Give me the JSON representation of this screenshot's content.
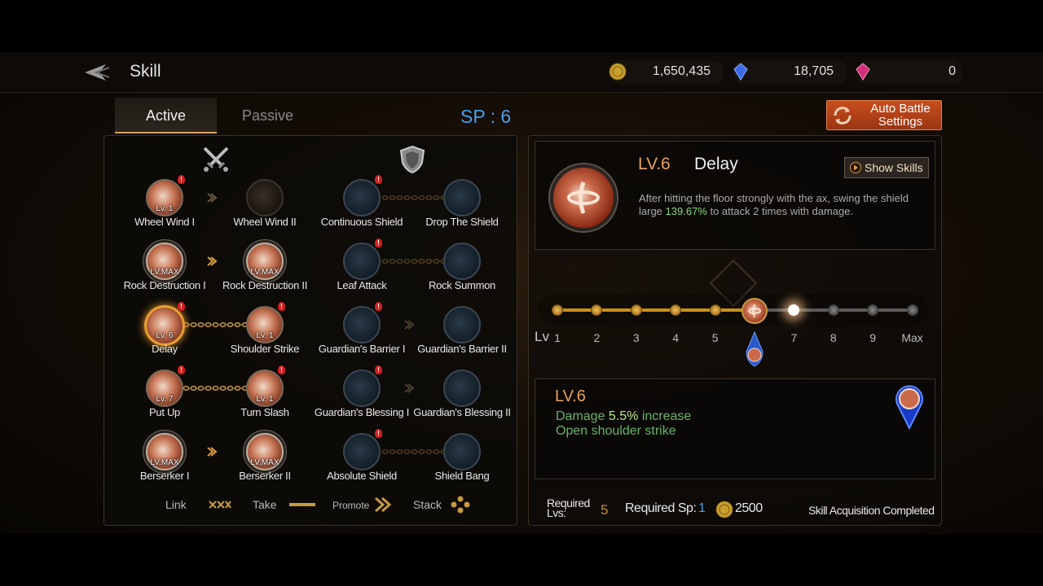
{
  "header": {
    "title": "Skill",
    "currencies": [
      {
        "icon": "gold-coin-icon",
        "value": "1,650,435"
      },
      {
        "icon": "blue-gem-icon",
        "value": "18,705"
      },
      {
        "icon": "pink-gem-icon",
        "value": "0"
      }
    ]
  },
  "tabs": {
    "active": "Active",
    "passive": "Passive"
  },
  "sp_label": "SP : 6",
  "auto_battle": "Auto Battle Settings",
  "skills": {
    "wheel_wind_1": {
      "name": "Wheel Wind I",
      "level": "Lv. 1"
    },
    "wheel_wind_2": {
      "name": "Wheel Wind II"
    },
    "continuous_shield": {
      "name": "Continuous Shield"
    },
    "drop_the_shield": {
      "name": "Drop The Shield"
    },
    "rock_destruction_1": {
      "name": "Rock Destruction I",
      "level": "LV.MAX"
    },
    "rock_destruction_2": {
      "name": "Rock Destruction II",
      "level": "LV.MAX"
    },
    "leaf_attack": {
      "name": "Leaf Attack"
    },
    "rock_summon": {
      "name": "Rock Summon"
    },
    "delay": {
      "name": "Delay",
      "level": "Lv. 6"
    },
    "shoulder_strike": {
      "name": "Shoulder Strike",
      "level": "Lv. 1"
    },
    "guardians_barrier_1": {
      "name": "Guardian's Barrier I"
    },
    "guardians_barrier_2": {
      "name": "Guardian's Barrier II"
    },
    "put_up": {
      "name": "Put Up",
      "level": "Lv. 7"
    },
    "turn_slash": {
      "name": "Turn Slash",
      "level": "Lv. 1"
    },
    "guardians_blessing_1": {
      "name": "Guardian's Blessing I"
    },
    "guardians_blessing_2": {
      "name": "Guardian's Blessing II"
    },
    "berserker_1": {
      "name": "Berserker I",
      "level": "LV.MAX"
    },
    "berserker_2": {
      "name": "Berserker II",
      "level": "LV.MAX"
    },
    "absolute_shield": {
      "name": "Absolute Shield"
    },
    "shield_bang": {
      "name": "Shield Bang"
    }
  },
  "legend": {
    "link": "Link",
    "take": "Take",
    "promote": "Promote",
    "stack": "Stack"
  },
  "detail": {
    "level": "LV.6",
    "name": "Delay",
    "show_skills": "Show Skills",
    "desc_1": "After hitting the floor strongly with the ax, swing the shield large ",
    "desc_hl": "139.67%",
    "desc_2": " to attack 2 times with damage.",
    "track_label": "Lv",
    "ticks": [
      "1",
      "2",
      "3",
      "4",
      "5",
      "",
      "7",
      "8",
      "9",
      "Max"
    ],
    "current_level_fraction": 0.6
  },
  "level_box": {
    "title": "LV.6",
    "line1_a": "Damage ",
    "line1_hl": "5.5%",
    "line1_b": " increase",
    "line2": "Open shoulder strike"
  },
  "requirements": {
    "lvs_label": "Required Lvs:",
    "lvs_value": "5",
    "sp_label": "Required Sp:",
    "sp_value": "1",
    "gold_value": "2500",
    "status": "Skill Acquisition Completed"
  },
  "colors": {
    "accent": "#e8a25a",
    "sp": "#4a9fe8",
    "highlight": "#8ad67a",
    "button": "#c84e1e"
  }
}
